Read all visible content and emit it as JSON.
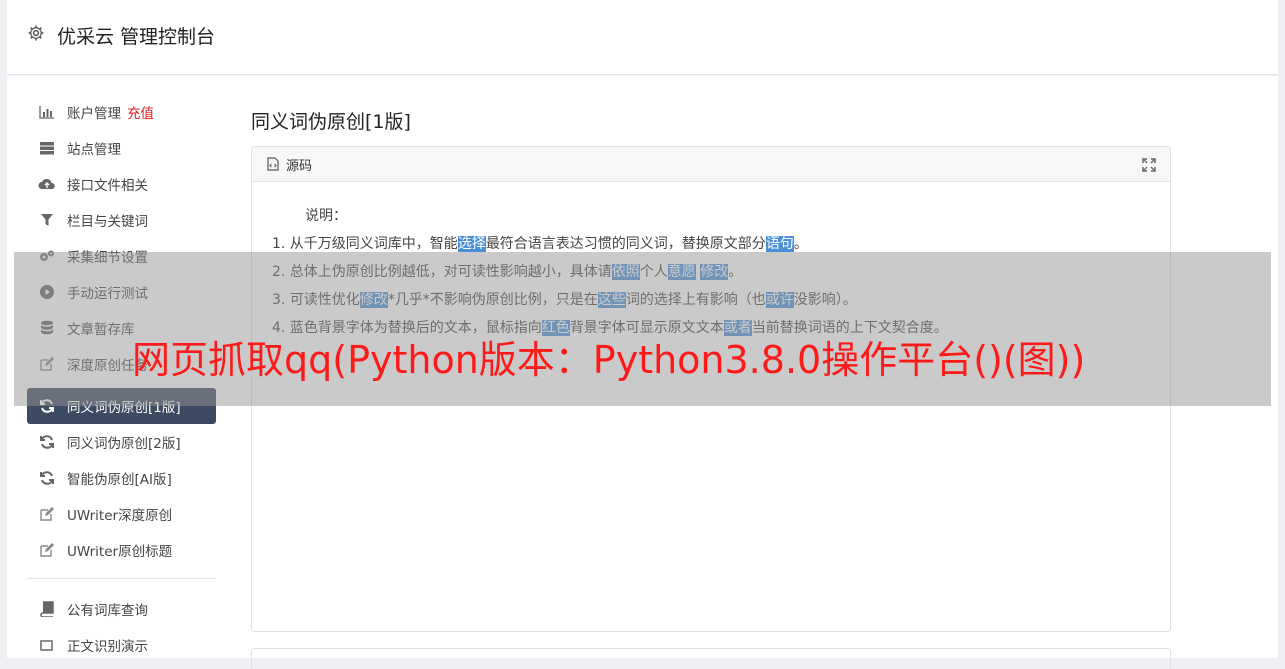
{
  "header": {
    "title": "优采云 管理控制台",
    "icon": "gear-icon"
  },
  "sidebar": {
    "items": [
      {
        "label": "账户管理",
        "badge": "充值",
        "icon": "bar-chart-icon"
      },
      {
        "label": "站点管理",
        "icon": "server-icon"
      },
      {
        "label": "接口文件相关",
        "icon": "cloud-upload-icon"
      },
      {
        "label": "栏目与关键词",
        "icon": "filter-icon"
      },
      {
        "label": "采集细节设置",
        "icon": "gears-icon"
      },
      {
        "label": "手动运行测试",
        "icon": "play-circle-icon"
      },
      {
        "label": "文章暂存库",
        "icon": "database-icon"
      },
      {
        "label": "深度原创任务",
        "icon": "edit-icon"
      },
      {
        "label": "同义词伪原创[1版]",
        "icon": "refresh-icon",
        "active": true
      },
      {
        "label": "同义词伪原创[2版]",
        "icon": "refresh-icon"
      },
      {
        "label": "智能伪原创[AI版]",
        "icon": "refresh-icon"
      },
      {
        "label": "UWriter深度原创",
        "icon": "edit-icon"
      },
      {
        "label": "UWriter原创标题",
        "icon": "edit-icon"
      }
    ],
    "items2": [
      {
        "label": "公有词库查询",
        "icon": "book-icon"
      },
      {
        "label": "正文识别演示",
        "icon": "crop-icon"
      }
    ]
  },
  "main": {
    "title": "同义词伪原创[1版]",
    "card": {
      "header": "源码",
      "note_title": "说明：",
      "lines": [
        {
          "parts": [
            {
              "t": "1. 从千万级同义词库中，智能"
            },
            {
              "t": "选择",
              "hl": true
            },
            {
              "t": "最符合语言表达习惯的同义词，替换原文部分"
            },
            {
              "t": "语句",
              "hl": true
            },
            {
              "t": "。"
            }
          ]
        },
        {
          "parts": [
            {
              "t": "2. 总体上伪原创比例越低，对可读性影响越小，具体请"
            },
            {
              "t": "依照",
              "hl": true
            },
            {
              "t": "个人"
            },
            {
              "t": "意愿",
              "hl": true
            },
            {
              "t": " "
            },
            {
              "t": "修改",
              "hl": true
            },
            {
              "t": "。"
            }
          ]
        },
        {
          "parts": [
            {
              "t": "3. 可读性优化"
            },
            {
              "t": "修改",
              "hl": true
            },
            {
              "t": "*几乎*不影响伪原创比例，只是在"
            },
            {
              "t": "这些",
              "hl": true
            },
            {
              "t": "词的选择上有影响（也"
            },
            {
              "t": "或许",
              "hl": true
            },
            {
              "t": "没影响）。"
            }
          ]
        },
        {
          "parts": [
            {
              "t": "4. 蓝色背景字体为替换后的文本，鼠标指向"
            },
            {
              "t": "红色",
              "hl": true
            },
            {
              "t": "背景字体可显示原文文本"
            },
            {
              "t": "或者",
              "hl": true
            },
            {
              "t": "当前替换词语的上下文契合度。"
            }
          ]
        }
      ]
    }
  },
  "overlay": {
    "text": "网页抓取qq(Python版本：Python3.8.0操作平台()(图))"
  },
  "colors": {
    "highlight": "#4a90d9",
    "active_bg": "#3c4b62",
    "overlay_text": "#ff1a1a",
    "recharge": "#e02020"
  }
}
